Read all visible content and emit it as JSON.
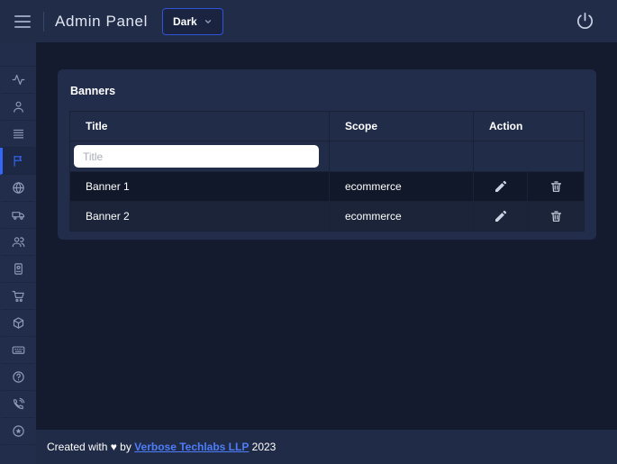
{
  "header": {
    "title": "Admin Panel",
    "theme_dropdown": {
      "value": "Dark"
    },
    "icons": [
      "menu-icon",
      "chevron-down-icon",
      "power-icon"
    ]
  },
  "sidebar": {
    "items": [
      {
        "icon": "activity",
        "active": false
      },
      {
        "icon": "user",
        "active": false
      },
      {
        "icon": "list",
        "active": false
      },
      {
        "icon": "flag",
        "active": true
      },
      {
        "icon": "globe",
        "active": false
      },
      {
        "icon": "truck",
        "active": false
      },
      {
        "icon": "users",
        "active": false
      },
      {
        "icon": "id-badge",
        "active": false
      },
      {
        "icon": "cart",
        "active": false
      },
      {
        "icon": "package",
        "active": false
      },
      {
        "icon": "keyboard",
        "active": false
      },
      {
        "icon": "help",
        "active": false
      },
      {
        "icon": "phone",
        "active": false
      },
      {
        "icon": "star-badge",
        "active": false
      }
    ]
  },
  "main": {
    "card": {
      "title": "Banners",
      "table": {
        "columns": [
          "Title",
          "Scope",
          "Action"
        ],
        "filter": {
          "title_placeholder": "Title"
        },
        "rows": [
          {
            "title": "Banner 1",
            "scope": "ecommerce",
            "actions": [
              "edit",
              "delete"
            ]
          },
          {
            "title": "Banner 2",
            "scope": "ecommerce",
            "actions": [
              "edit",
              "delete"
            ]
          }
        ]
      }
    }
  },
  "footer": {
    "text_prefix": "Created with ",
    "heart": "♥",
    "text_by": " by ",
    "link_text": "Verbose Techlabs LLP",
    "year": " 2023"
  },
  "colors": {
    "accent_blue": "#3566f5",
    "button_border_blue": "#2f54d9",
    "link_blue": "#4d7df8",
    "header_bg": "#212c48",
    "sidebar_bg": "#222d4b",
    "main_bg": "#141b2f",
    "card_bg": "#222d4c",
    "row_odd_bg": "#111829",
    "row_even_bg": "#1b2438",
    "icon_gray": "#8d99b5"
  }
}
